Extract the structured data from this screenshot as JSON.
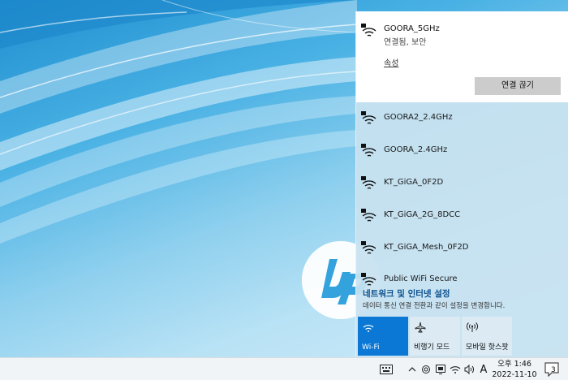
{
  "flyout": {
    "connected": {
      "ssid": "GOORA_5GHz",
      "status": "연결됨, 보안",
      "properties_label": "속성",
      "disconnect_label": "연결 끊기",
      "icon": "wifi-secured-icon"
    },
    "networks": [
      {
        "ssid": "GOORA2_2.4GHz",
        "icon": "wifi-secured-icon"
      },
      {
        "ssid": "GOORA_2.4GHz",
        "icon": "wifi-secured-icon"
      },
      {
        "ssid": "KT_GiGA_0F2D",
        "icon": "wifi-secured-icon"
      },
      {
        "ssid": "KT_GiGA_2G_8DCC",
        "icon": "wifi-secured-icon"
      },
      {
        "ssid": "KT_GiGA_Mesh_0F2D",
        "icon": "wifi-secured-icon"
      },
      {
        "ssid": "Public WiFi Secure",
        "icon": "wifi-secured-icon"
      }
    ],
    "settings_link": "네트워크 및 인터넷 설정",
    "settings_desc": "데이터 통신 연결 전환과 같이 설정을 변경합니다.",
    "quick_actions": [
      {
        "label": "Wi-Fi",
        "icon": "wifi-icon",
        "active": true
      },
      {
        "label": "비행기 모드",
        "icon": "airplane-icon",
        "active": false
      },
      {
        "label": "모바일 핫스팟",
        "icon": "hotspot-icon",
        "active": false
      }
    ]
  },
  "taskbar": {
    "time": "오후 1:46",
    "date": "2022-11-10",
    "ime": "A",
    "notification_count": "3",
    "tray_icons": [
      "touch-keyboard-icon",
      "chevron-up-icon",
      "meet-now-icon",
      "display-icon",
      "wifi-icon",
      "volume-icon"
    ]
  },
  "colors": {
    "accent": "#0a78d4",
    "flyout_bg": "#c8e2f0",
    "link": "#0a4f8c"
  }
}
